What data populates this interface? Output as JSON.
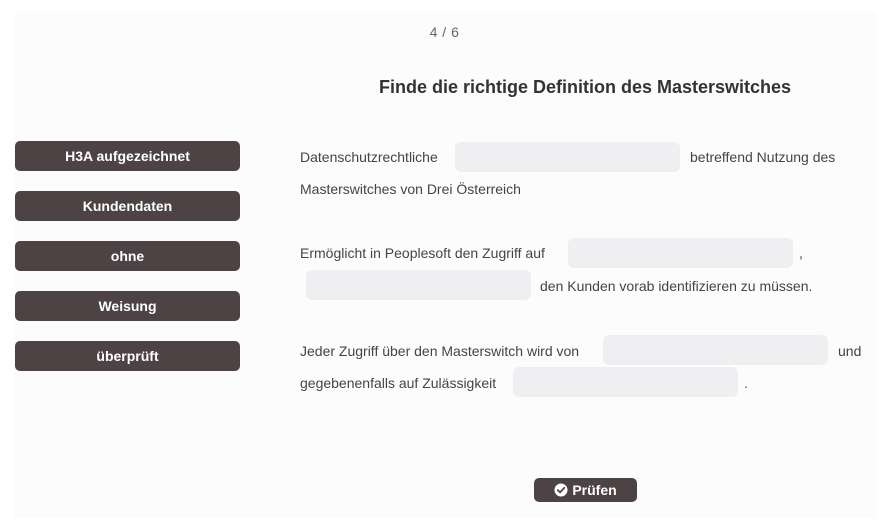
{
  "progress": "4 / 6",
  "title": "Finde die richtige Definition des Masterswitches",
  "chips": [
    "H3A aufgezeichnet",
    "Kundendaten",
    "ohne",
    "Weisung",
    "überprüft"
  ],
  "sentences": {
    "s1": {
      "part1": "Datenschutzrechtliche",
      "part2": "betreffend Nutzung des",
      "part3": "Masterswitches von Drei Österreich"
    },
    "s2": {
      "part1": "Ermöglicht in Peoplesoft den Zugriff auf",
      "part2": ",",
      "part3": "den Kunden vorab identifizieren zu müssen."
    },
    "s3": {
      "part1": "Jeder Zugriff über den Masterswitch wird von",
      "part2": "und",
      "part3": "gegebenenfalls auf Zulässigkeit",
      "part4": "."
    }
  },
  "check_button": {
    "label": "Prüfen",
    "icon": "check-circle-icon"
  },
  "colors": {
    "chip_bg": "#4e4344",
    "slot_bg": "#efeff1"
  }
}
